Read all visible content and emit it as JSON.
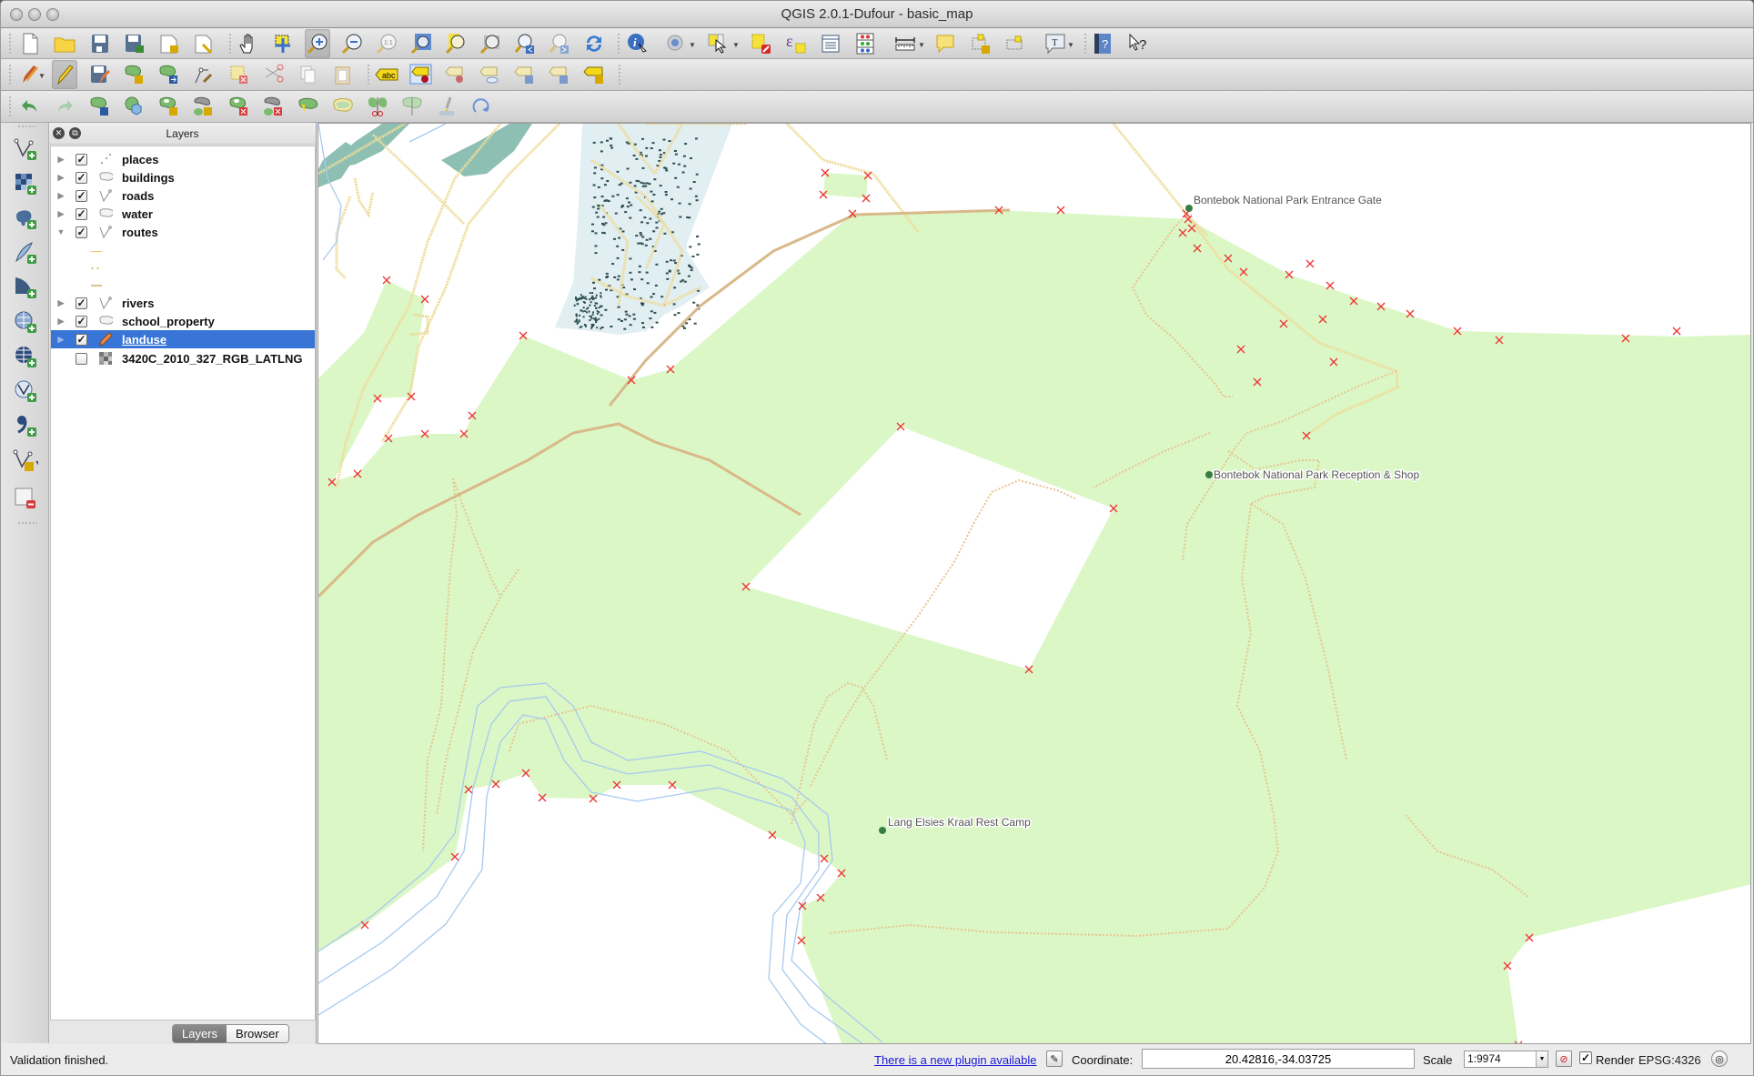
{
  "window": {
    "title": "QGIS 2.0.1-Dufour - basic_map"
  },
  "toolbars": {
    "file": [
      "new-project",
      "open-project",
      "save-project",
      "save-project-as",
      "new-print-composer",
      "composer-manager"
    ],
    "navigation": [
      "pan-map",
      "pan-to-selection",
      "zoom-in",
      "zoom-out",
      "zoom-actual-size",
      "zoom-full",
      "zoom-to-selection",
      "zoom-to-layer",
      "zoom-last",
      "zoom-next",
      "refresh"
    ],
    "attributes": [
      "identify-features",
      "run-feature-action",
      "select-features",
      "deselect-all",
      "select-by-expression",
      "open-attribute-table",
      "field-calculator",
      "measure-line",
      "map-tips",
      "new-bookmark",
      "show-bookmarks",
      "text-annotation",
      "help-contents",
      "whats-this"
    ],
    "digitizing": [
      "current-edits",
      "toggle-editing",
      "save-layer-edits",
      "add-feature",
      "move-feature",
      "node-tool",
      "delete-selected",
      "cut-features",
      "copy-features",
      "paste-features"
    ],
    "labels": [
      "layer-labeling-options",
      "pin-labels",
      "highlight-pinned-labels",
      "show-hide-labels",
      "move-label",
      "rotate-label",
      "change-label"
    ],
    "advanced_digitizing": [
      "undo",
      "redo",
      "rotate-feature",
      "simplify-feature",
      "add-ring",
      "add-part",
      "delete-ring",
      "delete-part",
      "reshape-features",
      "offset-curve",
      "split-features",
      "split-parts",
      "merge-selected-features",
      "rotate-point-symbols"
    ],
    "active": [
      "zoom-in",
      "toggle-editing"
    ]
  },
  "left_toolbar": [
    "add-vector-layer",
    "add-raster-layer",
    "add-postgis-layer",
    "add-spatialite-layer",
    "add-mssql-layer",
    "add-wms-layer",
    "add-wcs-layer",
    "add-wfs-layer",
    "add-delimited-text-layer",
    "new-shapefile-layer",
    "remove-layer"
  ],
  "layers_panel": {
    "title": "Layers",
    "layers": [
      {
        "name": "places",
        "checked": true,
        "expanded": false,
        "geometry": "point",
        "selected": false
      },
      {
        "name": "buildings",
        "checked": true,
        "expanded": false,
        "geometry": "polygon",
        "selected": false
      },
      {
        "name": "roads",
        "checked": true,
        "expanded": false,
        "geometry": "line",
        "selected": false
      },
      {
        "name": "water",
        "checked": true,
        "expanded": false,
        "geometry": "polygon",
        "selected": false
      },
      {
        "name": "routes",
        "checked": true,
        "expanded": true,
        "geometry": "line",
        "selected": false,
        "legend": [
          {
            "color": "#f0c060",
            "style": "solid"
          },
          {
            "color": "#e8d3a0",
            "style": "dotted"
          },
          {
            "color": "#d9c18b",
            "style": "thick"
          }
        ]
      },
      {
        "name": "rivers",
        "checked": true,
        "expanded": false,
        "geometry": "line",
        "selected": false
      },
      {
        "name": "school_property",
        "checked": true,
        "expanded": false,
        "geometry": "polygon",
        "selected": false
      },
      {
        "name": "landuse",
        "checked": true,
        "expanded": false,
        "geometry": "editing",
        "selected": true
      },
      {
        "name": "3420C_2010_327_RGB_LATLNG",
        "checked": false,
        "expanded": false,
        "geometry": "raster",
        "selected": false
      }
    ],
    "tabs": [
      {
        "label": "Layers",
        "active": true
      },
      {
        "label": "Browser",
        "active": false
      }
    ]
  },
  "map": {
    "labels": [
      {
        "text": "Bontebok National Park Entrance Gate"
      },
      {
        "text": "Bontebok National Park Reception & Shop"
      },
      {
        "text": "Lang Elsies Kraal Rest Camp"
      }
    ],
    "colors": {
      "landuse": "#dbf7c6",
      "town": "#e1eef2",
      "buildings": "#2f4f4f",
      "school": "#8dbfb3",
      "roads": "#eedc9a",
      "routes": "#e8c48e",
      "rivers": "#a7c9f0",
      "vertex": "#ee3333",
      "place": "#3a7d44"
    }
  },
  "status": {
    "message": "Validation finished.",
    "plugin_link": "There is a new plugin available",
    "coordinate_label": "Coordinate:",
    "coordinate_value": "20.42816,-34.03725",
    "scale_label": "Scale",
    "scale_value": "1:9974",
    "render_label": "Render",
    "render_checked": true,
    "crs": "EPSG:4326"
  }
}
